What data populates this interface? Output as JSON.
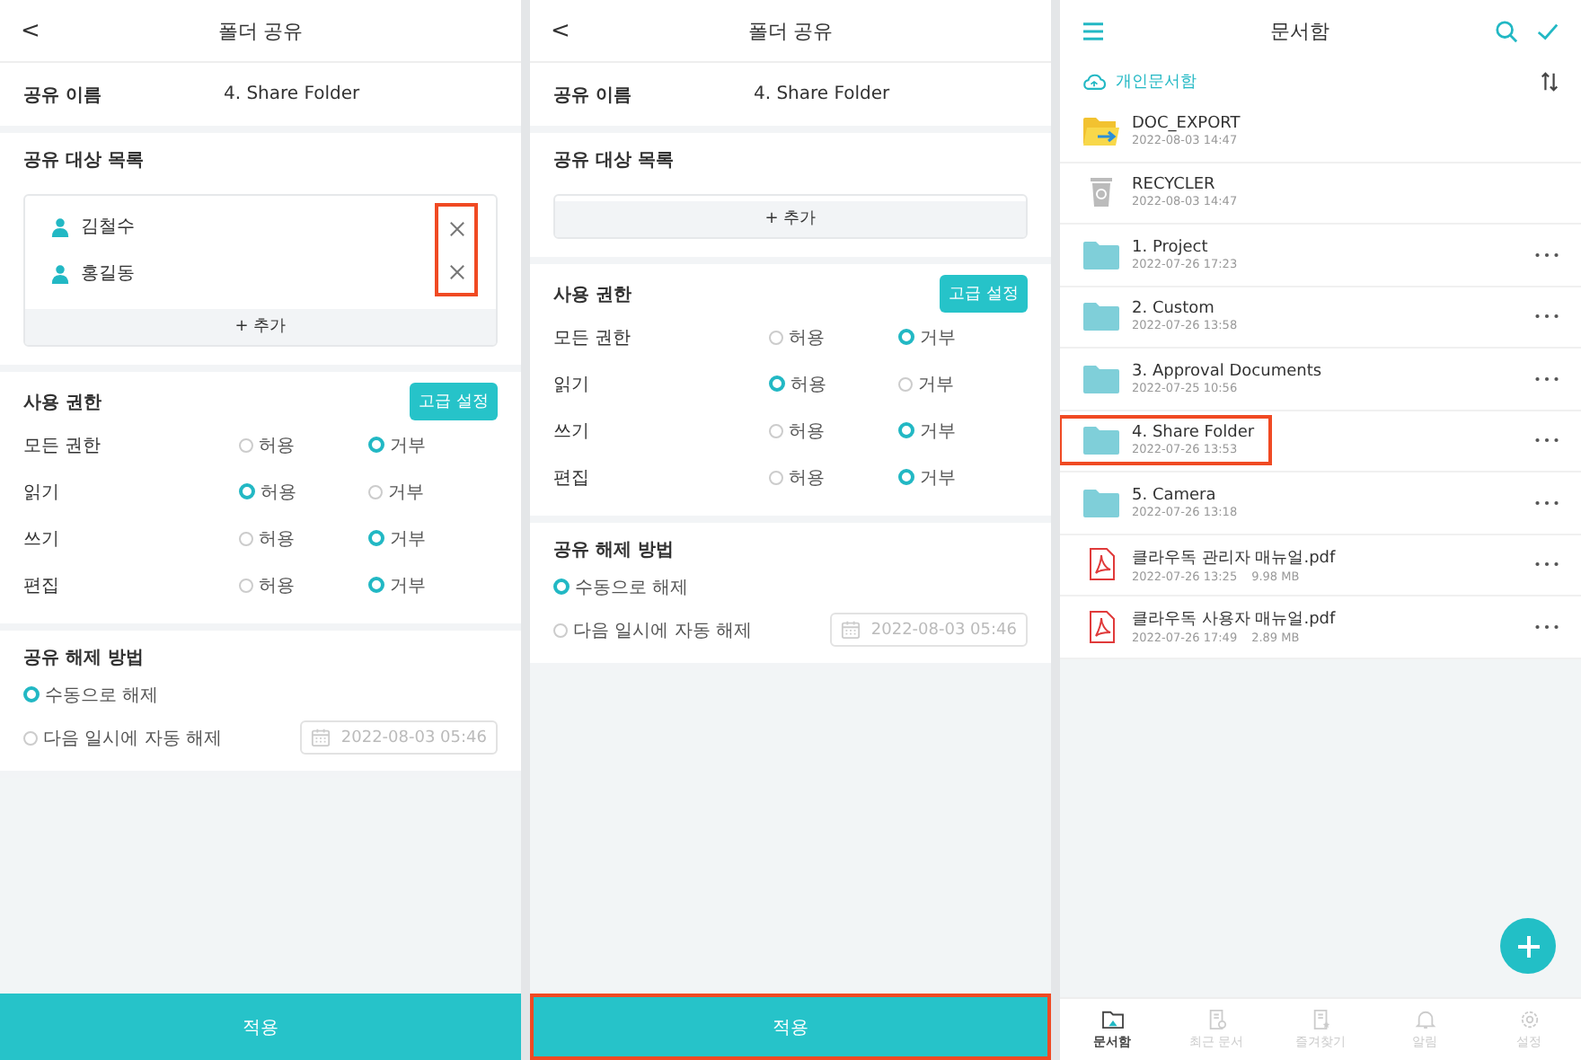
{
  "share_screens": [
    {
      "title": "폴더 공유",
      "back": "<",
      "share_name_label": "공유 이름",
      "share_name": "4. Share Folder",
      "targets_label": "공유 대상 목록",
      "targets": [
        {
          "name": "김철수"
        },
        {
          "name": "홍길동"
        }
      ],
      "remove_highlighted": true,
      "add_label": "+ 추가",
      "permissions_label": "사용 권한",
      "advanced_button": "고급 설정",
      "permissions": [
        {
          "label": "모든 권한",
          "options": [
            {
              "label": "허용",
              "selected": false
            },
            {
              "label": "거부",
              "selected": true
            }
          ]
        },
        {
          "label": "읽기",
          "options": [
            {
              "label": "허용",
              "selected": true
            },
            {
              "label": "거부",
              "selected": false
            }
          ]
        },
        {
          "label": "쓰기",
          "options": [
            {
              "label": "허용",
              "selected": false
            },
            {
              "label": "거부",
              "selected": true
            }
          ]
        },
        {
          "label": "편집",
          "options": [
            {
              "label": "허용",
              "selected": false
            },
            {
              "label": "거부",
              "selected": true
            }
          ]
        }
      ],
      "release_label": "공유 해제 방법",
      "release_options": [
        {
          "label": "수동으로 해제",
          "selected": true
        },
        {
          "label": "다음 일시에 자동 해제",
          "selected": false
        }
      ],
      "release_date": "2022-08-03 05:46",
      "apply_button": "적용",
      "apply_highlighted": false
    },
    {
      "title": "폴더 공유",
      "back": "<",
      "share_name_label": "공유 이름",
      "share_name": "4. Share Folder",
      "targets_label": "공유 대상 목록",
      "add_label": "+ 추가",
      "permissions_label": "사용 권한",
      "advanced_button": "고급 설정",
      "permissions": [
        {
          "label": "모든 권한",
          "options": [
            {
              "label": "허용",
              "selected": false
            },
            {
              "label": "거부",
              "selected": true
            }
          ]
        },
        {
          "label": "읽기",
          "options": [
            {
              "label": "허용",
              "selected": true
            },
            {
              "label": "거부",
              "selected": false
            }
          ]
        },
        {
          "label": "쓰기",
          "options": [
            {
              "label": "허용",
              "selected": false
            },
            {
              "label": "거부",
              "selected": true
            }
          ]
        },
        {
          "label": "편집",
          "options": [
            {
              "label": "허용",
              "selected": false
            },
            {
              "label": "거부",
              "selected": true
            }
          ]
        }
      ],
      "release_label": "공유 해제 방법",
      "release_options": [
        {
          "label": "수동으로 해제",
          "selected": true
        },
        {
          "label": "다음 일시에 자동 해제",
          "selected": false
        }
      ],
      "release_date": "2022-08-03 05:46",
      "apply_button": "적용",
      "apply_highlighted": true
    }
  ],
  "documents_screen": {
    "title": "문서함",
    "location": "개인문서함",
    "files": [
      {
        "kind": "export",
        "name": "DOC_EXPORT",
        "meta": "2022-08-03 14:47",
        "highlighted": false
      },
      {
        "kind": "trash",
        "name": "RECYCLER",
        "meta": "2022-08-03 14:47",
        "highlighted": false
      },
      {
        "kind": "folder",
        "name": "1. Project",
        "meta": "2022-07-26 17:23",
        "highlighted": false
      },
      {
        "kind": "folder",
        "name": "2. Custom",
        "meta": "2022-07-26 13:58",
        "highlighted": false
      },
      {
        "kind": "folder",
        "name": "3. Approval Documents",
        "meta": "2022-07-25 10:56",
        "highlighted": false
      },
      {
        "kind": "folder",
        "name": "4. Share Folder",
        "meta": "2022-07-26 13:53",
        "highlighted": true
      },
      {
        "kind": "folder",
        "name": "5. Camera",
        "meta": "2022-07-26 13:18",
        "highlighted": false
      },
      {
        "kind": "pdf",
        "name": "클라우독 관리자 매뉴얼.pdf",
        "meta": "2022-07-26 13:25",
        "size": "9.98 MB",
        "highlighted": false
      },
      {
        "kind": "pdf",
        "name": "클라우독 사용자 매뉴얼.pdf",
        "meta": "2022-07-26 17:49",
        "size": "2.89 MB",
        "highlighted": false
      }
    ],
    "nav": [
      {
        "label": "문서함",
        "kind": "folder",
        "selected": true
      },
      {
        "label": "최근 문서",
        "kind": "recent",
        "selected": false
      },
      {
        "label": "즐겨찾기",
        "kind": "star",
        "selected": false
      },
      {
        "label": "알림",
        "kind": "bell",
        "selected": false
      },
      {
        "label": "설정",
        "kind": "gear",
        "selected": false
      }
    ]
  }
}
